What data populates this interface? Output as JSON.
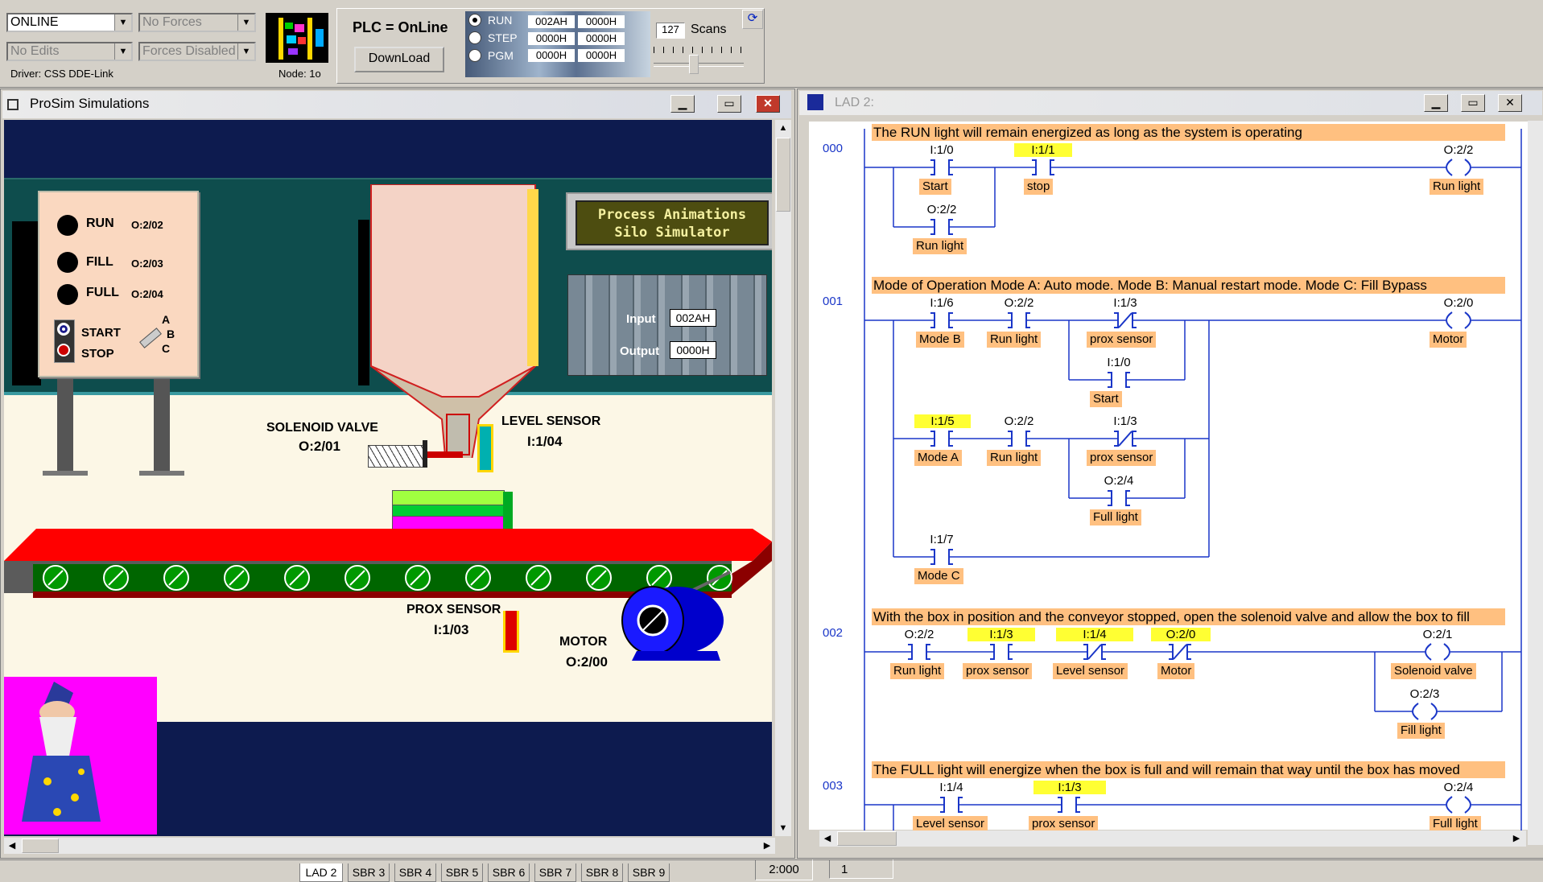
{
  "toolbar": {
    "mode_combo": "ONLINE",
    "forces_combo": "No Forces",
    "edits_combo": "No Edits",
    "forces_enabled_combo": "Forces Disabled",
    "driver": "Driver: CSS DDE-Link",
    "node": "Node: 1o",
    "plc_status": "PLC = OnLine",
    "download_label": "DownLoad",
    "radio_run": "RUN",
    "radio_step": "STEP",
    "radio_pgm": "PGM",
    "run_in": "002AH",
    "run_out": "0000H",
    "step_in": "0000H",
    "step_out": "0000H",
    "pgm_in": "0000H",
    "pgm_out": "0000H",
    "scans_value": "127",
    "scans_label": "Scans"
  },
  "prosim": {
    "title": "ProSim Simulations",
    "panel": {
      "run": "RUN",
      "run_addr": "O:2/02",
      "fill": "FILL",
      "fill_addr": "O:2/03",
      "full": "FULL",
      "full_addr": "O:2/04",
      "start": "START",
      "stop": "STOP",
      "mode_a": "A",
      "mode_b": "B",
      "mode_c": "C"
    },
    "sign_line1": "Process Animations",
    "sign_line2": "Silo Simulator",
    "plc_input_label": "Input",
    "plc_input_value": "002AH",
    "plc_output_label": "Output",
    "plc_output_value": "0000H",
    "solenoid_label": "SOLENOID VALVE",
    "solenoid_addr": "O:2/01",
    "level_label": "LEVEL SENSOR",
    "level_addr": "I:1/04",
    "prox_label": "PROX SENSOR",
    "prox_addr": "I:1/03",
    "motor_label": "MOTOR",
    "motor_addr": "O:2/00"
  },
  "lad": {
    "title": "LAD 2:",
    "rungs": {
      "r0": {
        "num": "000",
        "comment": "The RUN light will remain energized as long as the system is operating",
        "c1_addr": "I:1/0",
        "c1_tag": "Start",
        "c2_addr": "I:1/1",
        "c2_tag": "stop",
        "c3_addr": "O:2/2",
        "c3_tag": "Run light",
        "out_addr": "O:2/2",
        "out_tag": "Run light"
      },
      "r1": {
        "num": "001",
        "comment": "Mode of Operation  Mode A: Auto mode.  Mode B: Manual restart mode.  Mode C: Fill Bypass",
        "a1": "I:1/6",
        "t1": "Mode B",
        "a2": "O:2/2",
        "t2": "Run light",
        "a3": "I:1/3",
        "t3": "prox sensor",
        "a4": "I:1/0",
        "t4": "Start",
        "a5": "I:1/5",
        "t5": "Mode A",
        "a6": "O:2/2",
        "t6": "Run light",
        "a7": "I:1/3",
        "t7": "prox sensor",
        "a8": "O:2/4",
        "t8": "Full light",
        "a9": "I:1/7",
        "t9": "Mode C",
        "out_addr": "O:2/0",
        "out_tag": "Motor"
      },
      "r2": {
        "num": "002",
        "comment": "With the box in position and the conveyor stopped, open the solenoid valve and allow the box to fill",
        "a1": "O:2/2",
        "t1": "Run light",
        "a2": "I:1/3",
        "t2": "prox sensor",
        "a3": "I:1/4",
        "t3": "Level sensor",
        "a4": "O:2/0",
        "t4": "Motor",
        "out1_addr": "O:2/1",
        "out1_tag": "Solenoid valve",
        "out2_addr": "O:2/3",
        "out2_tag": "Fill light"
      },
      "r3": {
        "num": "003",
        "comment": "The FULL light will energize when the box is full and will remain that way until the box has moved",
        "a1": "I:1/4",
        "t1": "Level sensor",
        "a2": "I:1/3",
        "t2": "prox sensor",
        "out_addr": "O:2/4",
        "out_tag": "Full light"
      }
    }
  },
  "tabs": [
    "LAD 2",
    "SBR 3",
    "SBR 4",
    "SBR 5",
    "SBR 6",
    "SBR 7",
    "SBR 8",
    "SBR 9"
  ],
  "status": {
    "pos": "2:000",
    "val": "1"
  }
}
